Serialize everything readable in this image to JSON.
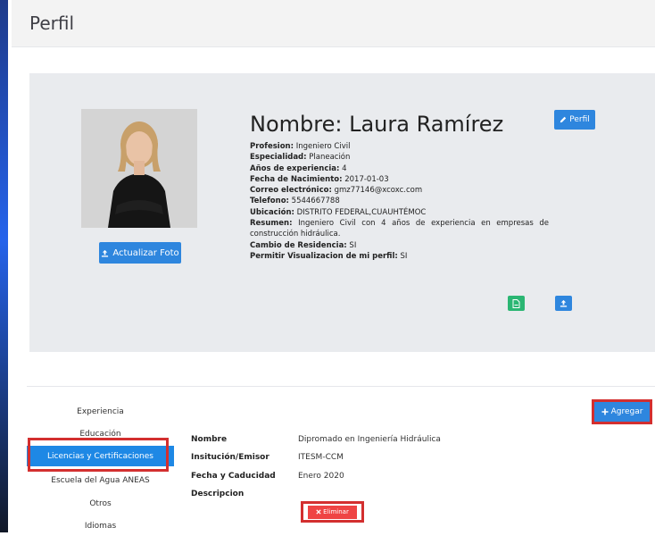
{
  "header": {
    "title": "Perfil"
  },
  "profile": {
    "name": "Nombre: Laura Ramírez",
    "update_photo_label": "Actualizar Foto",
    "profile_button_label": "Perfil",
    "details": [
      {
        "label": "Profesion:",
        "value": "Ingeniero Civil"
      },
      {
        "label": "Especialidad:",
        "value": "Planeación"
      },
      {
        "label": "Años de experiencia:",
        "value": "4"
      },
      {
        "label": "Fecha de Nacimiento:",
        "value": "2017-01-03"
      },
      {
        "label": "Correo electrónico:",
        "value": "gmz77146@xcoxc.com"
      },
      {
        "label": "Telefono:",
        "value": "5544667788"
      },
      {
        "label": "Ubicación:",
        "value": "DISTRITO FEDERAL,CUAUHTÉMOC"
      },
      {
        "label": "Resumen:",
        "value": "Ingeniero Civil con 4 años de experiencia en empresas de construcción hidráulica."
      },
      {
        "label": "Cambio de Residencia:",
        "value": "SI"
      },
      {
        "label": "Permitir Visualizacion de mi perfil:",
        "value": "SI"
      }
    ]
  },
  "sidebar": {
    "items": [
      {
        "label": "Experiencia"
      },
      {
        "label": "Educación"
      },
      {
        "label": "Licencias y Certificaciones"
      },
      {
        "label": "Escuela del Agua ANEAS"
      },
      {
        "label": "Otros"
      },
      {
        "label": "Idiomas"
      }
    ]
  },
  "certifications": {
    "add_label": "Agregar",
    "fields": [
      {
        "label": "Nombre",
        "value": "Dipromado en Ingeniería Hidráulica"
      },
      {
        "label": "Insitución/Emisor",
        "value": "ITESM-CCM"
      },
      {
        "label": "Fecha y Caducidad",
        "value": "Enero 2020"
      },
      {
        "label": "Descripcion",
        "value": ""
      }
    ],
    "delete_label": "Eliminar"
  },
  "colors": {
    "primary": "#2e86de",
    "success": "#2bb673",
    "danger": "#ef4444",
    "highlight": "#d32f2f"
  }
}
